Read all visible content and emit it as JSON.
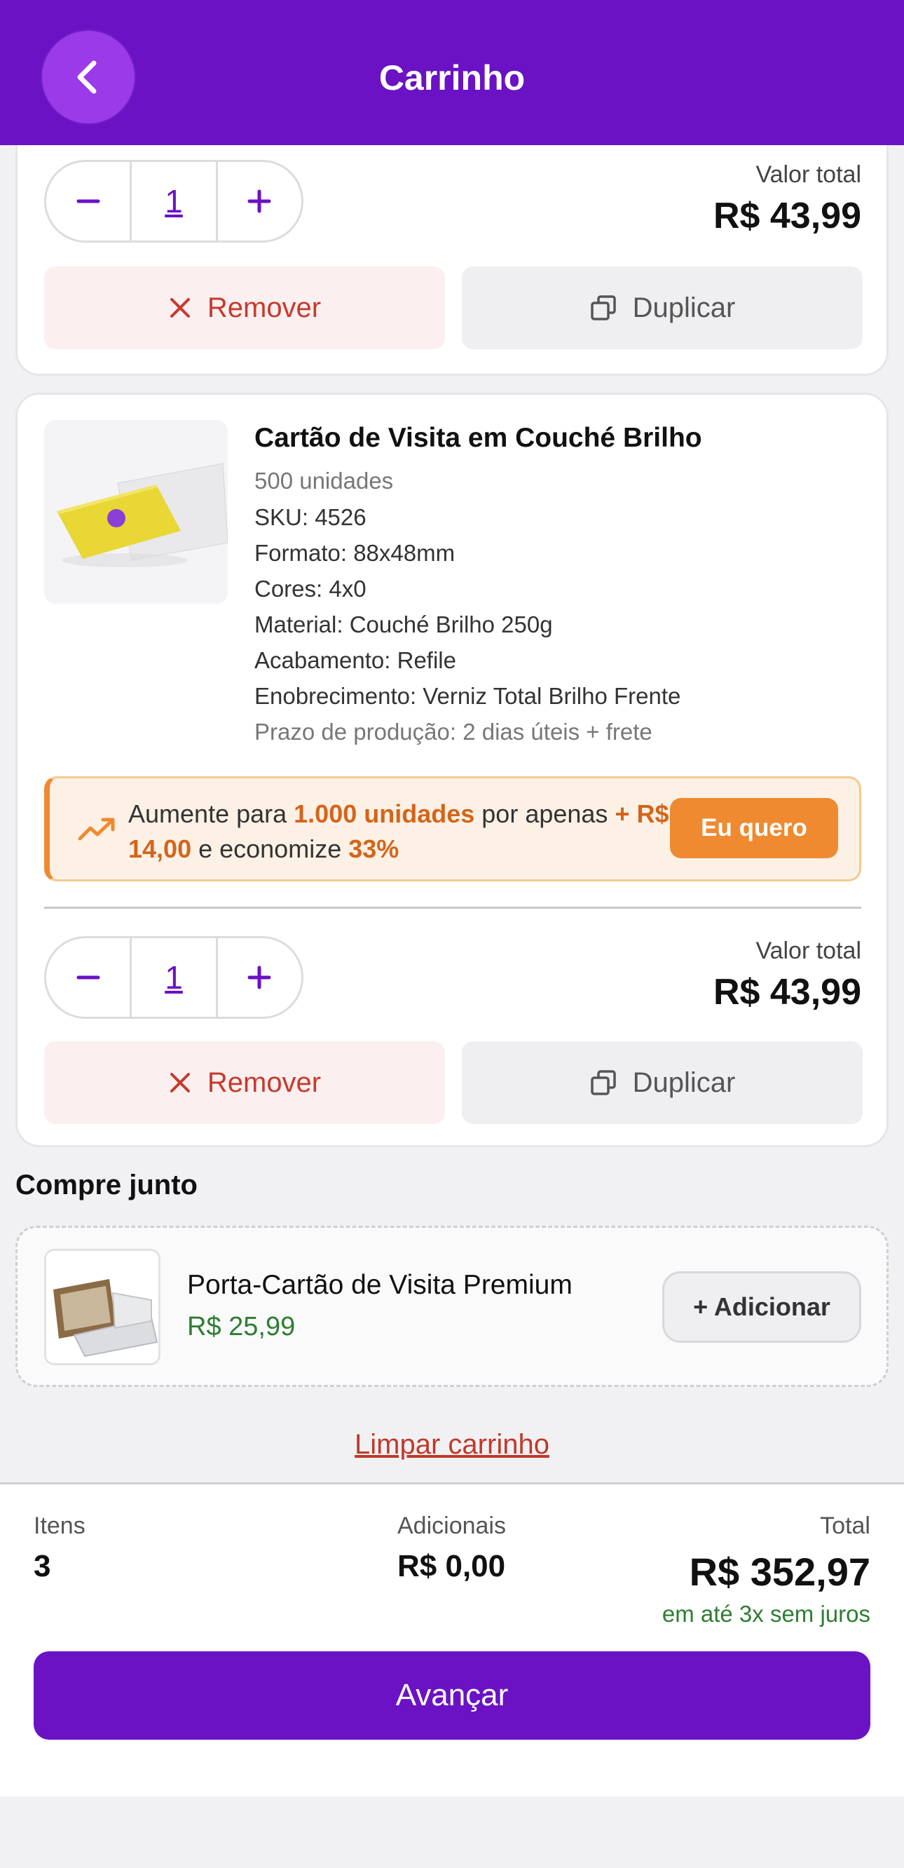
{
  "header": {
    "title": "Carrinho"
  },
  "items": [
    {
      "quantity": "1",
      "total_label": "Valor total",
      "total_value": "R$ 43,99",
      "remove_label": "Remover",
      "duplicate_label": "Duplicar"
    },
    {
      "name": "Cartão de Visita em Couché Brilho",
      "units": "500 unidades",
      "sku": "SKU: 4526",
      "format": "Formato: 88x48mm",
      "colors": "Cores: 4x0",
      "material": "Material: Couché Brilho 250g",
      "finish": "Acabamento: Refile",
      "enhancement": "Enobrecimento: Verniz Total Brilho Frente",
      "production": "Prazo de produção: 2 dias úteis + frete",
      "upsell": {
        "t1": "Aumente para ",
        "units": "1.000 unidades",
        "t2": " por apenas ",
        "price": "+ R$ 14,00",
        "t3": " e economize ",
        "percent": "33%",
        "button": "Eu quero"
      },
      "quantity": "1",
      "total_label": "Valor total",
      "total_value": "R$ 43,99",
      "remove_label": "Remover",
      "duplicate_label": "Duplicar"
    }
  ],
  "bundle": {
    "section_title": "Compre junto",
    "name": "Porta-Cartão de Visita Premium",
    "price": "R$ 25,99",
    "add_label": "+ Adicionar"
  },
  "clear_label": "Limpar carrinho",
  "summary": {
    "items_label": "Itens",
    "items_value": "3",
    "extras_label": "Adicionais",
    "extras_value": "R$ 0,00",
    "total_label": "Total",
    "total_value": "R$ 352,97",
    "installments": "em até 3x sem juros",
    "next_label": "Avançar"
  },
  "colors": {
    "primary": "#6a12c4",
    "accent_orange": "#ef8a30",
    "remove_red": "#c63a2e",
    "price_green": "#2e7d32"
  }
}
